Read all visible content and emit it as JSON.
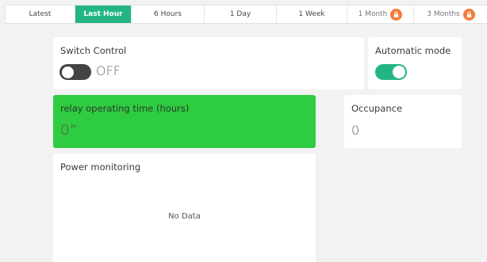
{
  "tabs": [
    {
      "label": "Latest",
      "active": false,
      "locked": false
    },
    {
      "label": "Last Hour",
      "active": true,
      "locked": false
    },
    {
      "label": "6 Hours",
      "active": false,
      "locked": false
    },
    {
      "label": "1 Day",
      "active": false,
      "locked": false
    },
    {
      "label": "1 Week",
      "active": false,
      "locked": false
    },
    {
      "label": "1 Month",
      "active": false,
      "locked": true
    },
    {
      "label": "3 Months",
      "active": false,
      "locked": true
    }
  ],
  "widgets": {
    "switch_control": {
      "title": "Switch Control",
      "state": "OFF",
      "on": false
    },
    "automatic_mode": {
      "title": "Automatic mode",
      "on": true
    },
    "relay_time": {
      "title": "relay operating time (hours)",
      "value": "0",
      "unit": "hr",
      "color": "#2ecc40"
    },
    "occupance": {
      "title": "Occupance",
      "value": "0"
    },
    "power_monitoring": {
      "title": "Power monitoring",
      "empty_text": "No Data"
    }
  },
  "colors": {
    "accent": "#23b684",
    "lock_badge": "#f47b3a",
    "relay_bg": "#2ecc40"
  },
  "icons": {
    "lock": "lock-icon"
  }
}
